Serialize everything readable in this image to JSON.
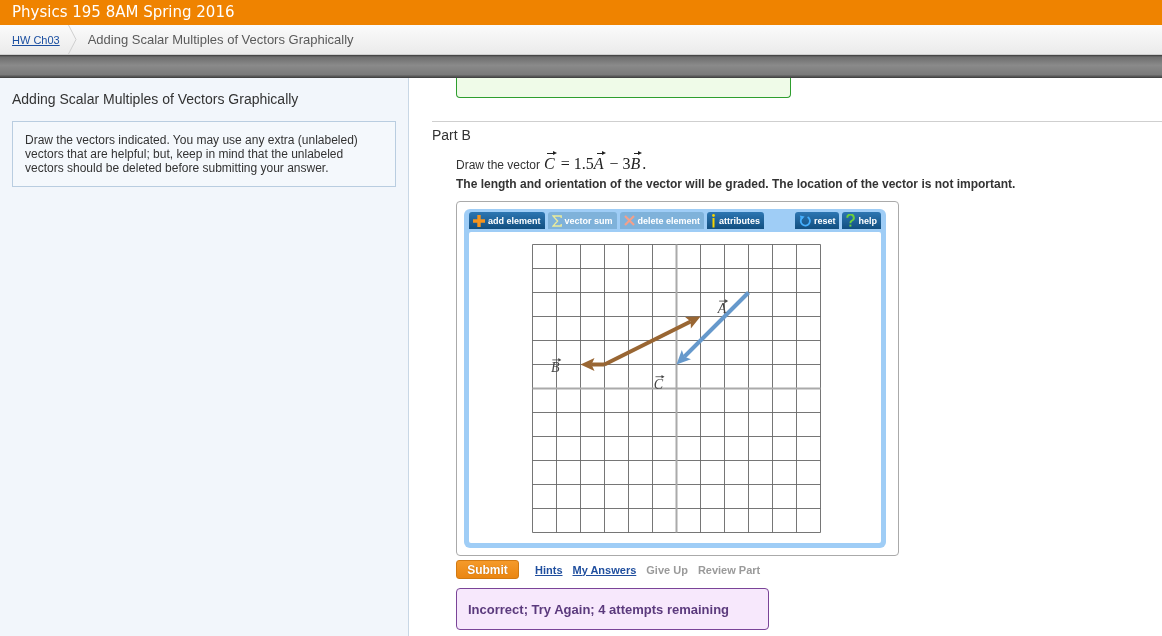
{
  "header": {
    "title": "Physics 195 8AM Spring 2016"
  },
  "breadcrumb": [
    {
      "label": "HW Ch03",
      "kind": "link"
    },
    {
      "label": "Adding Scalar Multiples of Vectors Graphically",
      "kind": "current"
    }
  ],
  "sidebar": {
    "title": "Adding Scalar Multiples of Vectors Graphically",
    "instructions": "Draw the vectors indicated. You may use any extra (unlabeled) vectors that are helpful; but, keep in mind that the unlabeled vectors should be deleted before submitting your answer."
  },
  "previous_feedback": {
    "kind": "correct"
  },
  "part": {
    "title": "Part B",
    "prompt": "Draw the vector",
    "formula": "C = 1.5A − 3B.",
    "note": "The length and orientation of the vector will be graded. The location of the vector is not important."
  },
  "applet": {
    "tools": [
      {
        "label": "add element",
        "kind": "add",
        "disabled": false
      },
      {
        "label": "vector sum",
        "kind": "sum",
        "disabled": true
      },
      {
        "label": "delete element",
        "kind": "delete",
        "disabled": true
      },
      {
        "label": "attributes",
        "kind": "attributes",
        "disabled": false
      }
    ],
    "utilities": [
      {
        "label": "reset",
        "kind": "reset"
      },
      {
        "label": "help",
        "kind": "help"
      }
    ],
    "vectors": [
      {
        "label": "A",
        "color": "#6699cc"
      },
      {
        "label": "B",
        "color": "#996633"
      },
      {
        "label": "C",
        "color": "#996633"
      }
    ]
  },
  "actions": {
    "submit": "Submit",
    "links": [
      {
        "label": "Hints",
        "disabled": false
      },
      {
        "label": "My Answers",
        "disabled": false
      },
      {
        "label": "Give Up",
        "disabled": true
      },
      {
        "label": "Review Part",
        "disabled": true
      }
    ]
  },
  "feedback": {
    "kind": "incorrect",
    "message": "Incorrect; Try Again; 4 attempts remaining"
  }
}
